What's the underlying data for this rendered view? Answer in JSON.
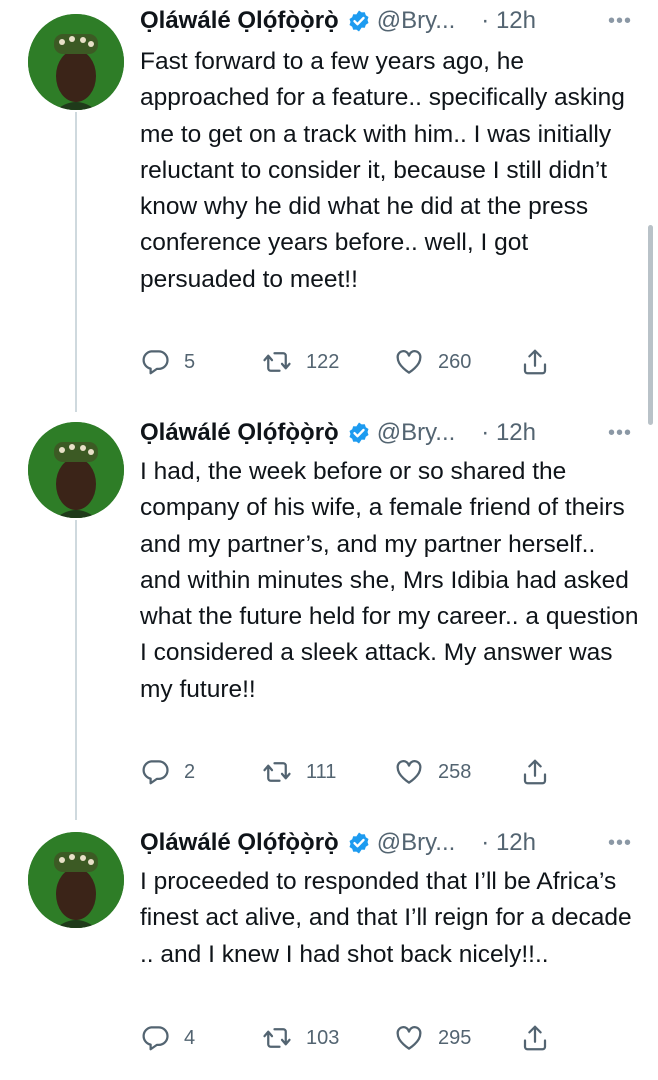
{
  "tweets": [
    {
      "name": "Ọláwálé  Ọlọ́fọ̀ọ̀rọ̀",
      "handle": "@Bry...",
      "time": "· 12h",
      "text": "Fast forward to a few years ago, he approached for a feature.. specifically asking me to get on a track with him.. I was initially reluctant to consider it, because I still didn’t know why he did what he did at the press conference years before.. well, I got persuaded to meet!!",
      "replies": "5",
      "retweets": "122",
      "likes": "260"
    },
    {
      "name": "Ọláwálé  Ọlọ́fọ̀ọ̀rọ̀",
      "handle": "@Bry...",
      "time": "· 12h",
      "text": "I had, the week before or so shared the company of his wife, a female friend of theirs and my partner’s, and my partner herself..  and within minutes she, Mrs Idibia  had asked what the future held for my career.. a question I considered a sleek attack. My answer was my future!!",
      "replies": "2",
      "retweets": "111",
      "likes": "258"
    },
    {
      "name": "Ọláwálé  Ọlọ́fọ̀ọ̀rọ̀",
      "handle": "@Bry...",
      "time": "· 12h",
      "text": "I proceeded to responded that I’ll be Africa’s finest act alive, and that I’ll reign for a decade .. and I knew I had shot back nicely!!..",
      "replies": "4",
      "retweets": "103",
      "likes": "295"
    }
  ],
  "more_glyph": "•••",
  "colors": {
    "verified": "#1d9bf0",
    "muted": "#536471",
    "line": "#cfd9de"
  },
  "icons": [
    "reply-icon",
    "retweet-icon",
    "like-icon",
    "share-icon",
    "verified-badge-icon",
    "more-icon"
  ]
}
